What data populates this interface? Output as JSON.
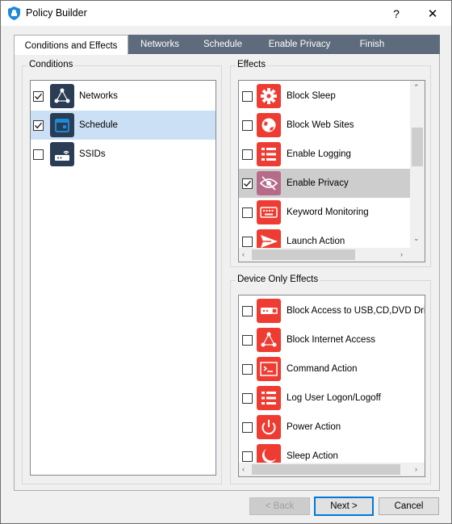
{
  "window": {
    "title": "Policy Builder",
    "help": "?",
    "close": "✕"
  },
  "tabs": [
    "Conditions and Effects",
    "Networks",
    "Schedule",
    "Enable Privacy",
    "Finish"
  ],
  "conditions": {
    "title": "Conditions",
    "items": [
      {
        "label": "Networks",
        "checked": true,
        "icon": "network-icon"
      },
      {
        "label": "Schedule",
        "checked": true,
        "icon": "calendar-icon"
      },
      {
        "label": "SSIDs",
        "checked": false,
        "icon": "router-icon"
      }
    ]
  },
  "effects": {
    "title": "Effects",
    "items": [
      {
        "label": "Block Sleep",
        "checked": false,
        "icon": "gear-icon"
      },
      {
        "label": "Block Web Sites",
        "checked": false,
        "icon": "globe-icon"
      },
      {
        "label": "Enable Logging",
        "checked": false,
        "icon": "list-icon"
      },
      {
        "label": "Enable Privacy",
        "checked": true,
        "icon": "eye-slash-icon"
      },
      {
        "label": "Keyword Monitoring",
        "checked": false,
        "icon": "keyboard-icon"
      },
      {
        "label": "Launch Action",
        "checked": false,
        "icon": "send-icon"
      }
    ]
  },
  "device_effects": {
    "title": "Device Only Effects",
    "items": [
      {
        "label": "Block Access to USB,CD,DVD Drives",
        "checked": false,
        "icon": "usb-icon"
      },
      {
        "label": "Block Internet Access",
        "checked": false,
        "icon": "network-icon"
      },
      {
        "label": "Command Action",
        "checked": false,
        "icon": "terminal-icon"
      },
      {
        "label": "Log User Logon/Logoff",
        "checked": false,
        "icon": "list-icon"
      },
      {
        "label": "Power Action",
        "checked": false,
        "icon": "power-icon"
      },
      {
        "label": "Sleep Action",
        "checked": false,
        "icon": "moon-icon"
      }
    ]
  },
  "buttons": {
    "back": "< Back",
    "next": "Next >",
    "cancel": "Cancel"
  },
  "colors": {
    "tabstrip": "#5d6b7c",
    "icon_dark": "#2a3d55",
    "icon_red": "#ef3c32",
    "selection": "#cce0f5"
  }
}
